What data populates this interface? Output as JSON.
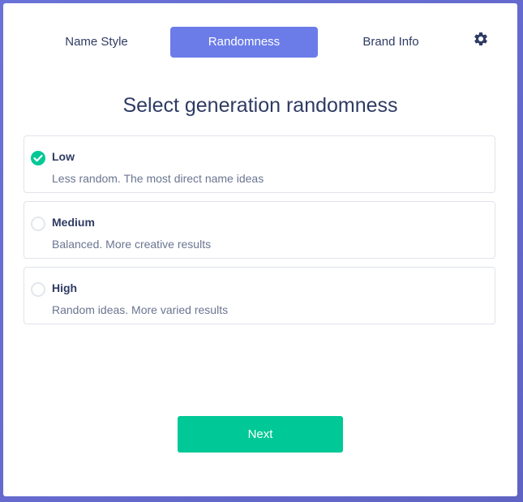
{
  "tabs": [
    {
      "label": "Name Style",
      "active": false
    },
    {
      "label": "Randomness",
      "active": true
    },
    {
      "label": "Brand Info",
      "active": false
    }
  ],
  "settings_icon": "gear-icon",
  "title": "Select generation randomness",
  "options": [
    {
      "label": "Low",
      "description": "Less random. The most direct name ideas",
      "selected": true
    },
    {
      "label": "Medium",
      "description": "Balanced. More creative results",
      "selected": false
    },
    {
      "label": "High",
      "description": "Random ideas. More varied results",
      "selected": false
    }
  ],
  "next_label": "Next",
  "colors": {
    "accent": "#6b7ce9",
    "success": "#00c896",
    "text": "#2f3b63",
    "muted": "#6a7590"
  }
}
